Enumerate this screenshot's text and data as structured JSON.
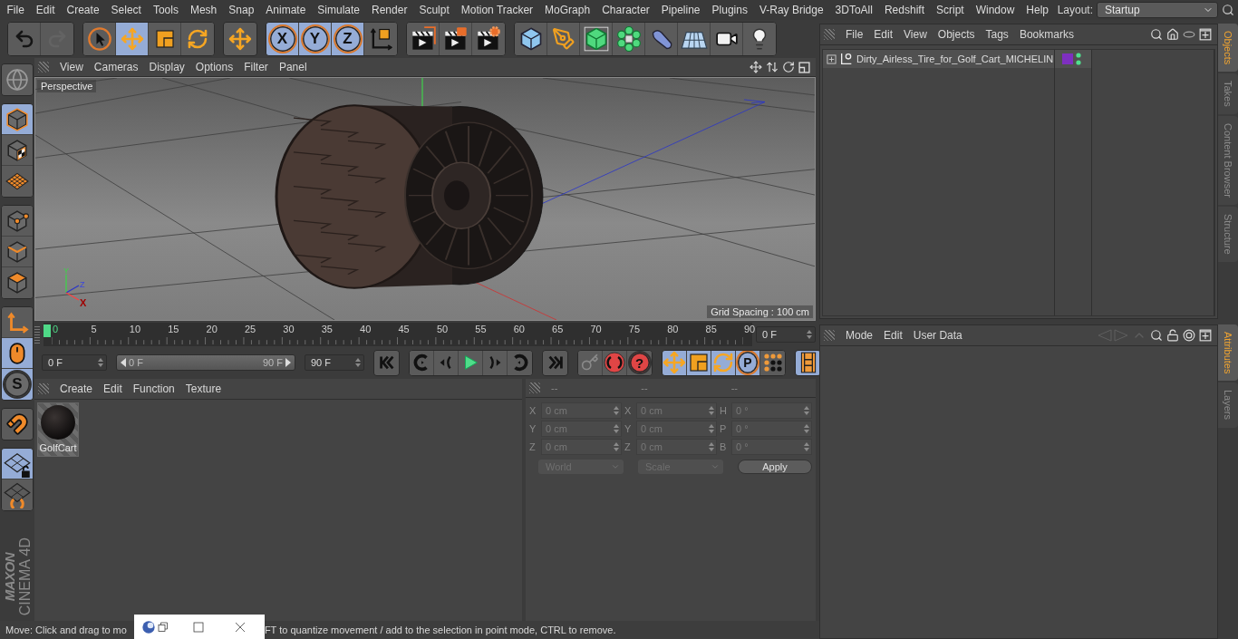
{
  "menu_bar": {
    "items": [
      "File",
      "Edit",
      "Create",
      "Select",
      "Tools",
      "Mesh",
      "Snap",
      "Animate",
      "Simulate",
      "Render",
      "Sculpt",
      "Motion Tracker",
      "MoGraph",
      "Character",
      "Pipeline",
      "Plugins",
      "V-Ray Bridge",
      "3DToAll",
      "Redshift",
      "Script",
      "Window",
      "Help"
    ],
    "layout_label": "Layout:",
    "layout_value": "Startup"
  },
  "toolbar": [
    [
      {
        "kind": "undo",
        "selected": false,
        "disabled": false
      },
      {
        "kind": "redo",
        "selected": false,
        "disabled": true
      }
    ],
    [
      {
        "kind": "select",
        "selected": false
      },
      {
        "kind": "move",
        "selected": true
      },
      {
        "kind": "scale",
        "selected": false
      },
      {
        "kind": "rotate",
        "selected": false
      }
    ],
    [
      {
        "kind": "move",
        "selected": false
      }
    ],
    [
      {
        "kind": "lock",
        "label": "X",
        "selected": true
      },
      {
        "kind": "lock",
        "label": "Y",
        "selected": true
      },
      {
        "kind": "lock",
        "label": "Z",
        "selected": true
      },
      {
        "kind": "world",
        "selected": false
      }
    ],
    [
      {
        "kind": "render-view",
        "selected": false
      },
      {
        "kind": "render-picture",
        "selected": false
      },
      {
        "kind": "render-settings",
        "selected": false
      }
    ],
    [
      {
        "kind": "cube",
        "selected": false
      },
      {
        "kind": "pen",
        "selected": false
      },
      {
        "kind": "subdivision",
        "selected": false
      },
      {
        "kind": "cloner",
        "selected": false
      },
      {
        "kind": "deformer",
        "selected": false
      },
      {
        "kind": "floor",
        "selected": false
      },
      {
        "kind": "camera",
        "selected": false
      },
      {
        "kind": "light",
        "selected": false
      }
    ]
  ],
  "mode_toolbar": [
    [
      {
        "kind": "globe",
        "selected": false
      }
    ],
    [
      {
        "kind": "model",
        "selected": true
      },
      {
        "kind": "texture",
        "selected": false
      },
      {
        "kind": "workplane",
        "selected": false
      }
    ],
    [
      {
        "kind": "points",
        "selected": false
      },
      {
        "kind": "edges",
        "selected": false
      },
      {
        "kind": "polygons",
        "selected": false
      }
    ],
    [
      {
        "kind": "axis",
        "selected": false
      },
      {
        "kind": "tweak",
        "selected": true
      },
      {
        "kind": "solo",
        "label": "S",
        "selected": true
      }
    ],
    [
      {
        "kind": "magnet",
        "selected": false
      }
    ],
    [
      {
        "kind": "grid-lock",
        "selected": true
      },
      {
        "kind": "grid-sync",
        "selected": false
      }
    ]
  ],
  "logo": {
    "brand": "MAXON",
    "product": "CINEMA 4D"
  },
  "viewport": {
    "menu": [
      "View",
      "Cameras",
      "Display",
      "Options",
      "Filter",
      "Panel"
    ],
    "camera": "Perspective",
    "grid_spacing": "Grid Spacing : 100 cm",
    "axis_labels": [
      "Y",
      "Z",
      "X"
    ]
  },
  "timeline": {
    "ticks": [
      "0",
      "5",
      "10",
      "15",
      "20",
      "25",
      "30",
      "35",
      "40",
      "45",
      "50",
      "55",
      "60",
      "65",
      "70",
      "75",
      "80",
      "85",
      "90"
    ],
    "level": 0,
    "current_frame": "0 F"
  },
  "transport": {
    "start": "0 F",
    "range": {
      "start": "0 F",
      "end": "90 F",
      "level": 1
    },
    "end": "90 F",
    "groups": [
      [
        {
          "kind": "first-frame",
          "selected": false
        }
      ],
      [
        {
          "kind": "prev-key",
          "selected": false
        },
        {
          "kind": "prev-frame",
          "selected": false
        },
        {
          "kind": "play",
          "selected": false
        },
        {
          "kind": "next-frame",
          "selected": false
        },
        {
          "kind": "next-key",
          "selected": false
        }
      ],
      [
        {
          "kind": "last-frame",
          "selected": false
        }
      ],
      [
        {
          "kind": "record-key",
          "selected": false
        },
        {
          "kind": "auto-key",
          "selected": false
        },
        {
          "kind": "help",
          "label": "?",
          "selected": false
        }
      ],
      [
        {
          "kind": "move",
          "selected": true
        },
        {
          "kind": "scale",
          "selected": true
        },
        {
          "kind": "rotate",
          "selected": true
        },
        {
          "kind": "param",
          "label": "P",
          "selected": true
        },
        {
          "kind": "dots",
          "selected": false
        }
      ],
      [
        {
          "kind": "film",
          "selected": true
        }
      ]
    ]
  },
  "materials": {
    "menu": [
      "Create",
      "Edit",
      "Function",
      "Texture"
    ],
    "items": [
      {
        "name": "GolfCart"
      }
    ]
  },
  "coordinates": {
    "headers": [
      "--",
      "--",
      "--"
    ],
    "rows": [
      {
        "axis": "X",
        "position": "0 cm",
        "size_axis": "X",
        "size": "0 cm",
        "rotation_axis": "H",
        "rotation": "0 °"
      },
      {
        "axis": "Y",
        "position": "0 cm",
        "size_axis": "Y",
        "size": "0 cm",
        "rotation_axis": "P",
        "rotation": "0 °"
      },
      {
        "axis": "Z",
        "position": "0 cm",
        "size_axis": "Z",
        "size": "0 cm",
        "rotation_axis": "B",
        "rotation": "0 °"
      }
    ],
    "space": "World",
    "mode": "Scale",
    "apply": "Apply"
  },
  "objects": {
    "menu": [
      "File",
      "Edit",
      "View",
      "Objects",
      "Tags",
      "Bookmarks"
    ],
    "rows": [
      {
        "name": "Dirty_Airless_Tire_for_Golf_Cart_MICHELIN",
        "expanded": false,
        "color": "#7e2fc0"
      }
    ]
  },
  "object_tabs": [
    {
      "label": "Objects",
      "selected": true
    },
    {
      "label": "Takes",
      "selected": false
    },
    {
      "label": "Content Browser",
      "selected": false
    },
    {
      "label": "Structure",
      "selected": false
    }
  ],
  "attributes": {
    "menu": [
      "Mode",
      "Edit",
      "User Data"
    ]
  },
  "attribute_tabs": [
    {
      "label": "Attributes",
      "selected": true
    },
    {
      "label": "Layers",
      "selected": false
    }
  ],
  "status_bar": {
    "segments": [
      "Move: Click and drag to mo",
      "FT to quantize movement / add to the selection in point mode, CTRL to remove."
    ]
  }
}
